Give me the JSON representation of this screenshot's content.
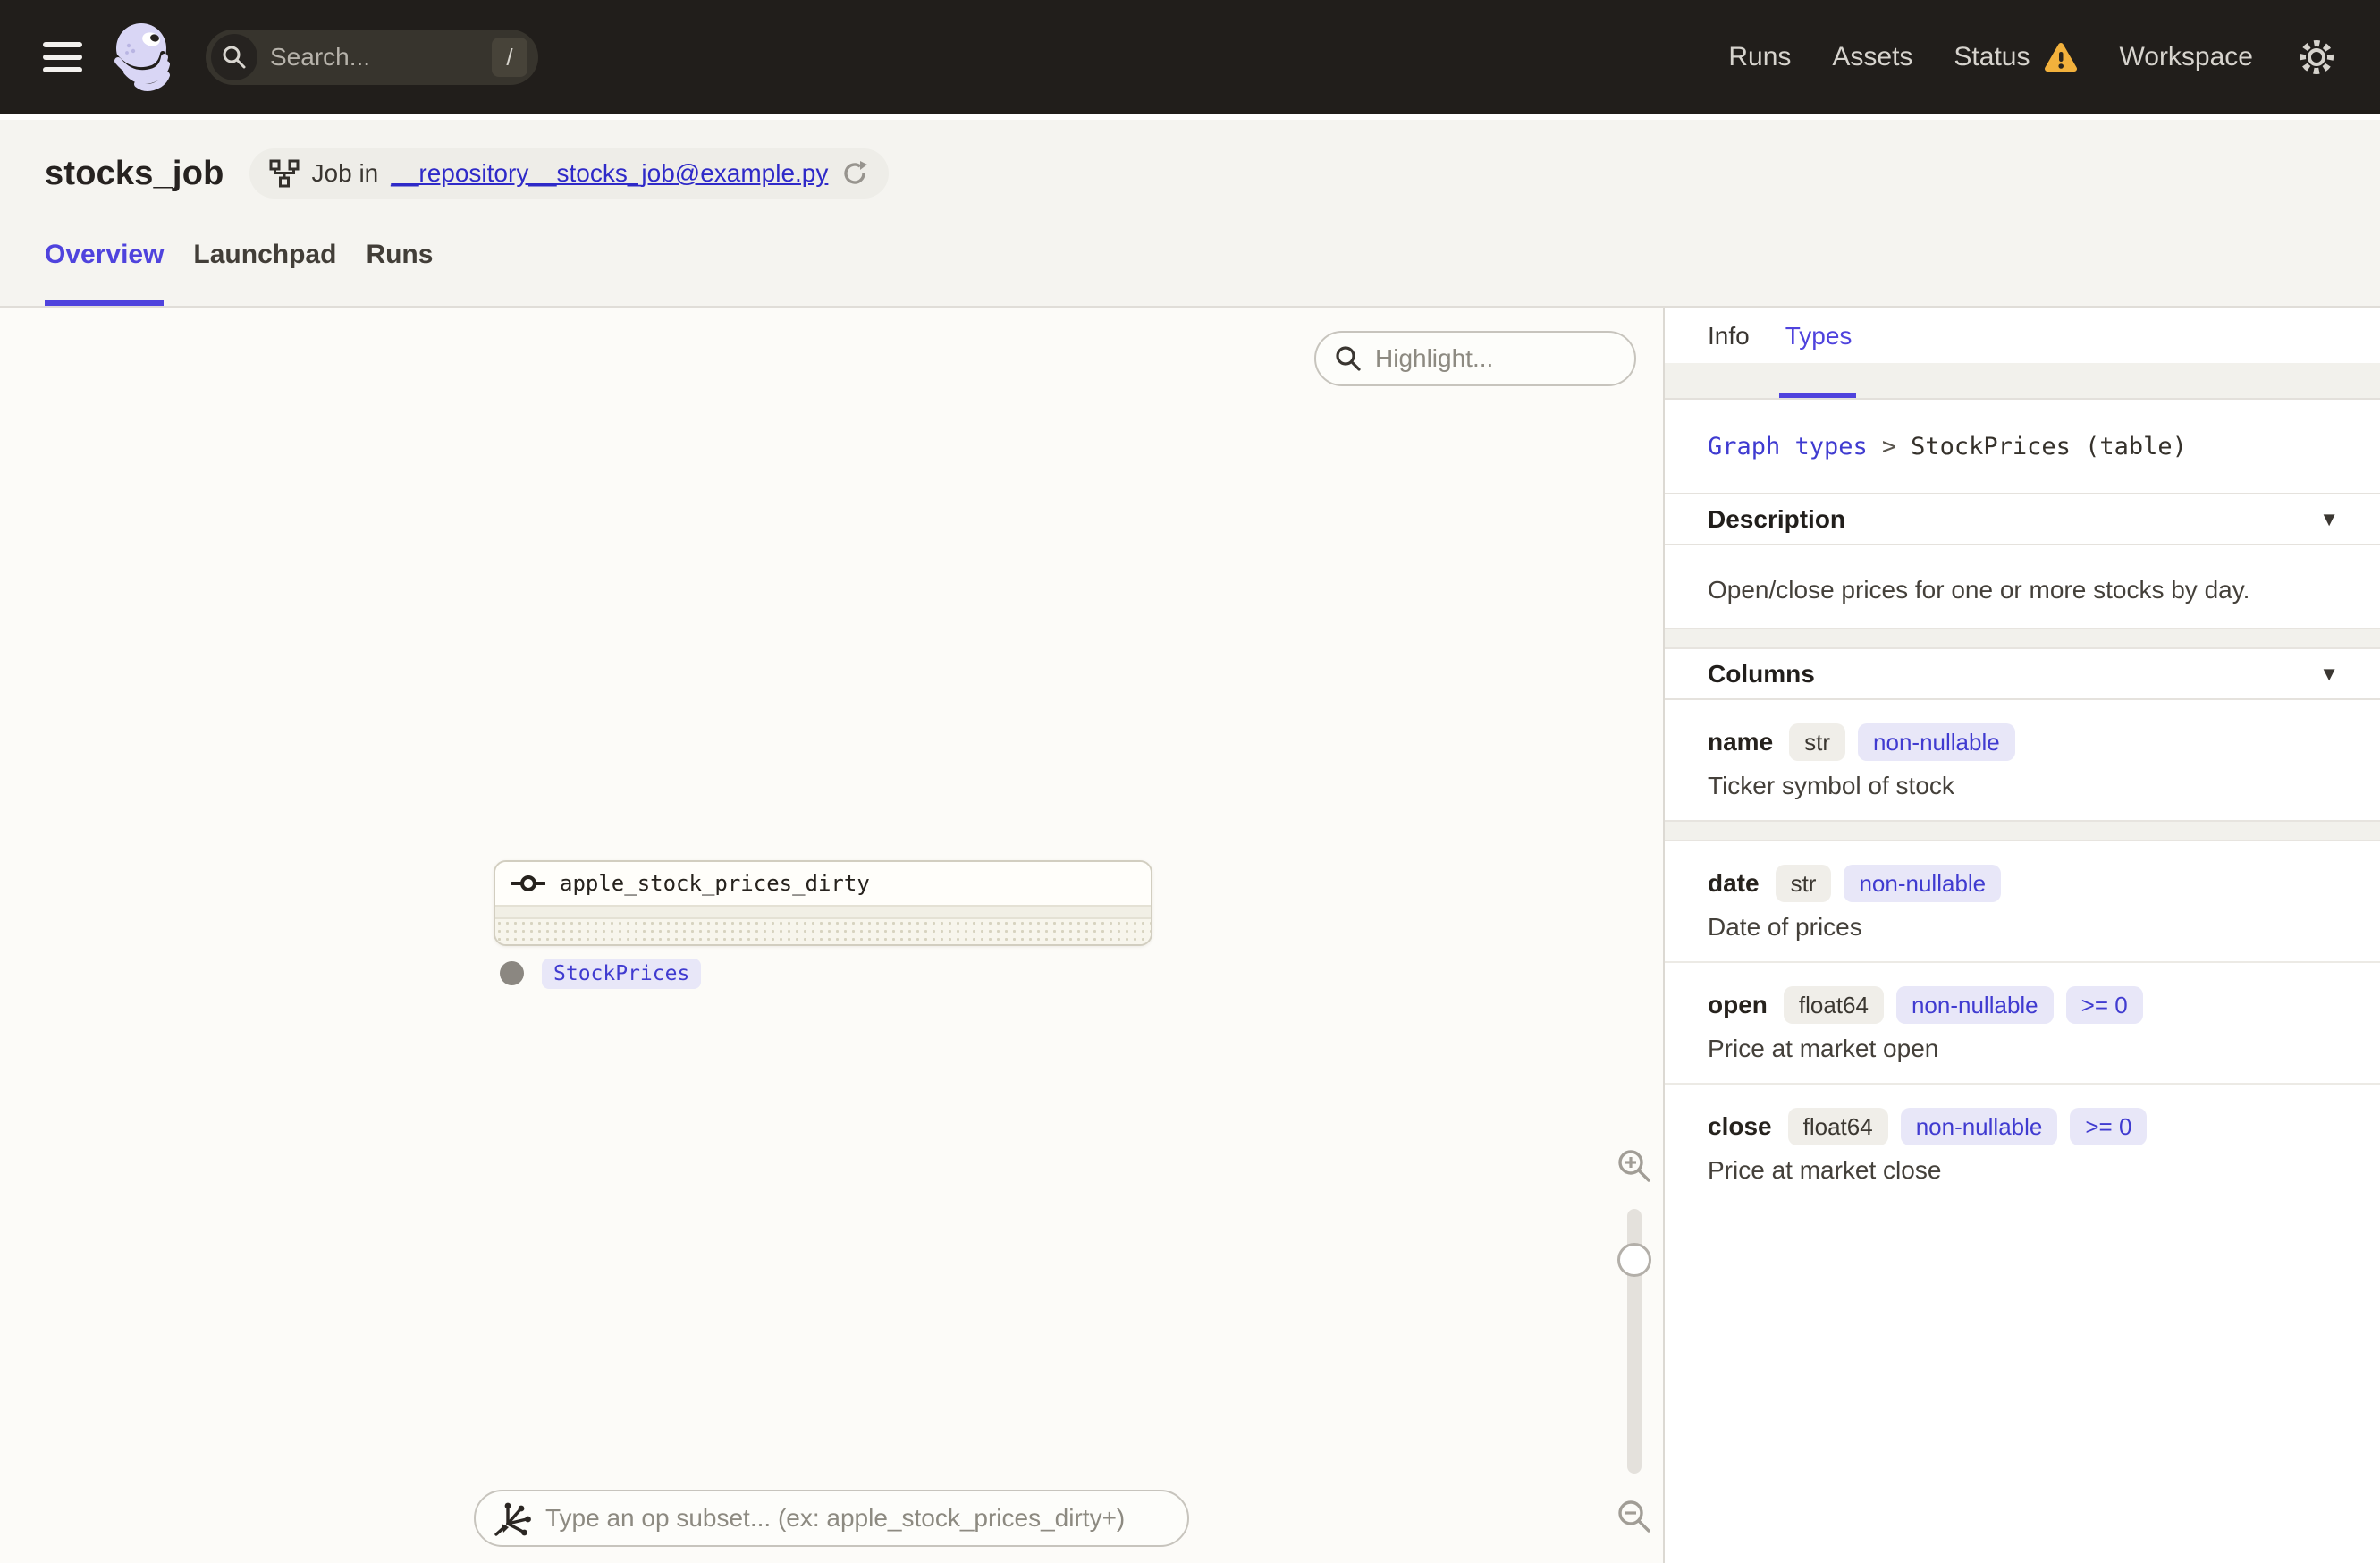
{
  "colors": {
    "accent": "#4f43dd",
    "accent_text": "#403bd0",
    "warning": "#f2b13c",
    "nav_bg": "#211e1b",
    "header_bg": "#f5f4f0",
    "badge_accent_bg": "#e8e7f8",
    "badge_neutral_bg": "#f0eee9"
  },
  "nav": {
    "search": {
      "placeholder": "Search...",
      "shortcut": "/"
    },
    "links": [
      {
        "label": "Runs"
      },
      {
        "label": "Assets"
      },
      {
        "label": "Status",
        "warning": true
      },
      {
        "label": "Workspace"
      }
    ]
  },
  "header": {
    "title": "stocks_job",
    "job_prefix": "Job in",
    "job_link": "__repository__stocks_job@example.py",
    "tabs": [
      {
        "label": "Overview",
        "active": true
      },
      {
        "label": "Launchpad",
        "active": false
      },
      {
        "label": "Runs",
        "active": false
      }
    ]
  },
  "graph": {
    "highlight_placeholder": "Highlight...",
    "node": {
      "title": "apple_stock_prices_dirty"
    },
    "output_badge": "StockPrices",
    "subset_placeholder": "Type an op subset... (ex: apple_stock_prices_dirty+)"
  },
  "panel": {
    "tabs": [
      {
        "label": "Info",
        "active": false
      },
      {
        "label": "Types",
        "active": true
      }
    ],
    "breadcrumb": {
      "link": "Graph types",
      "separator": ">",
      "current": "StockPrices (table)"
    },
    "description_section": {
      "title": "Description",
      "text": "Open/close prices for one or more stocks by day."
    },
    "columns_section": {
      "title": "Columns"
    },
    "columns": [
      {
        "name": "name",
        "type": "str",
        "tags": [
          "non-nullable"
        ],
        "description": "Ticker symbol of stock"
      },
      {
        "name": "date",
        "type": "str",
        "tags": [
          "non-nullable"
        ],
        "description": "Date of prices"
      },
      {
        "name": "open",
        "type": "float64",
        "tags": [
          "non-nullable",
          ">= 0"
        ],
        "description": "Price at market open"
      },
      {
        "name": "close",
        "type": "float64",
        "tags": [
          "non-nullable",
          ">= 0"
        ],
        "description": "Price at market close"
      }
    ]
  }
}
